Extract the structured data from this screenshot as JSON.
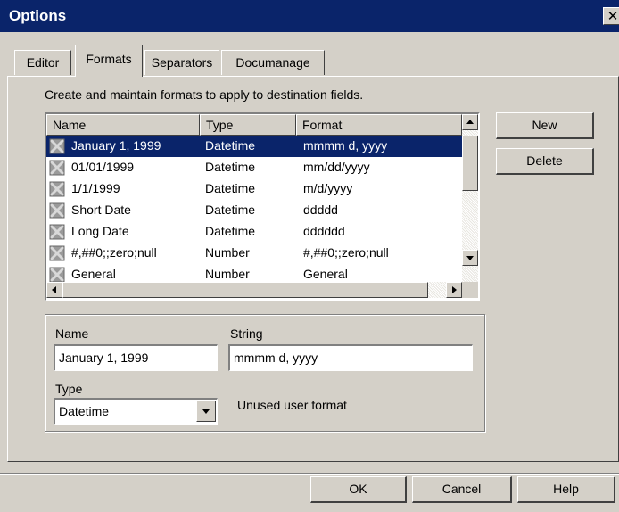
{
  "window": {
    "title": "Options",
    "close_glyph": "✕"
  },
  "tabs": [
    "Editor",
    "Formats",
    "Separators",
    "Documanage"
  ],
  "active_tab": "Formats",
  "intro_text": "Create and maintain formats to apply to destination fields.",
  "list": {
    "columns": [
      "Name",
      "Type",
      "Format"
    ],
    "rows": [
      {
        "name": "January 1, 1999",
        "type": "Datetime",
        "format": "mmmm d, yyyy",
        "selected": true
      },
      {
        "name": "01/01/1999",
        "type": "Datetime",
        "format": "mm/dd/yyyy"
      },
      {
        "name": "1/1/1999",
        "type": "Datetime",
        "format": "m/d/yyyy"
      },
      {
        "name": "Short Date",
        "type": "Datetime",
        "format": "ddddd"
      },
      {
        "name": "Long Date",
        "type": "Datetime",
        "format": "dddddd"
      },
      {
        "name": "#,##0;;zero;null",
        "type": "Number",
        "format": "#,##0;;zero;null"
      },
      {
        "name": "General",
        "type": "Number",
        "format": "General"
      }
    ],
    "row_icon": "format-icon"
  },
  "buttons": {
    "new": "New",
    "delete": "Delete"
  },
  "detail": {
    "name_label": "Name",
    "name_value": "January 1, 1999",
    "string_label": "String",
    "string_value": "mmmm d, yyyy",
    "type_label": "Type",
    "type_value": "Datetime",
    "status": "Unused user format"
  },
  "footer": {
    "ok": "OK",
    "cancel": "Cancel",
    "help": "Help"
  },
  "colors": {
    "titlebar": "#0a246a",
    "face": "#d4d0c8",
    "selection": "#0a246a"
  }
}
